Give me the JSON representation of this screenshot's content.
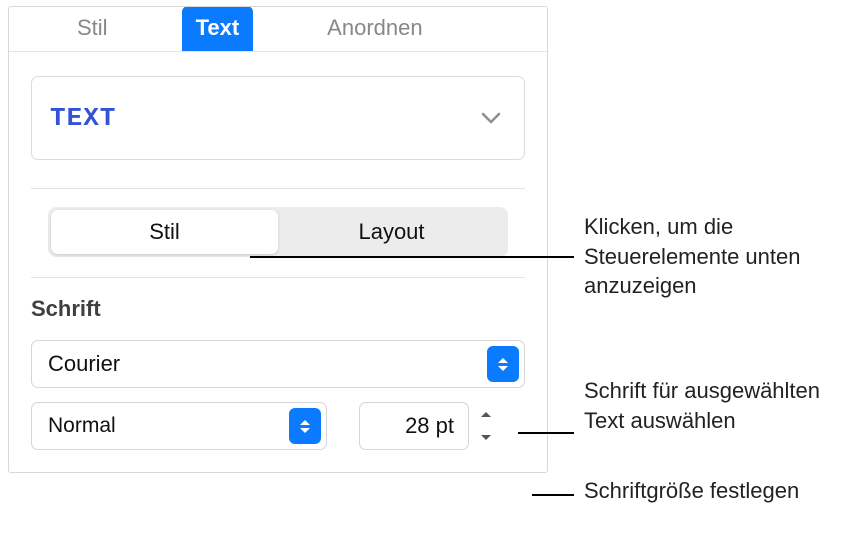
{
  "topnav": {
    "style": "Stil",
    "text": "Text",
    "arrange": "Anordnen"
  },
  "style_picker": {
    "label": "TEXT"
  },
  "seg": {
    "style": "Stil",
    "layout": "Layout"
  },
  "font_section": {
    "title": "Schrift",
    "family": "Courier",
    "weight": "Normal",
    "size": "28 pt"
  },
  "callouts": {
    "c1": "Klicken, um die Steuerelemente unten anzuzeigen",
    "c2": "Schrift für ausgewählten Text auswählen",
    "c3": "Schriftgröße festlegen"
  }
}
